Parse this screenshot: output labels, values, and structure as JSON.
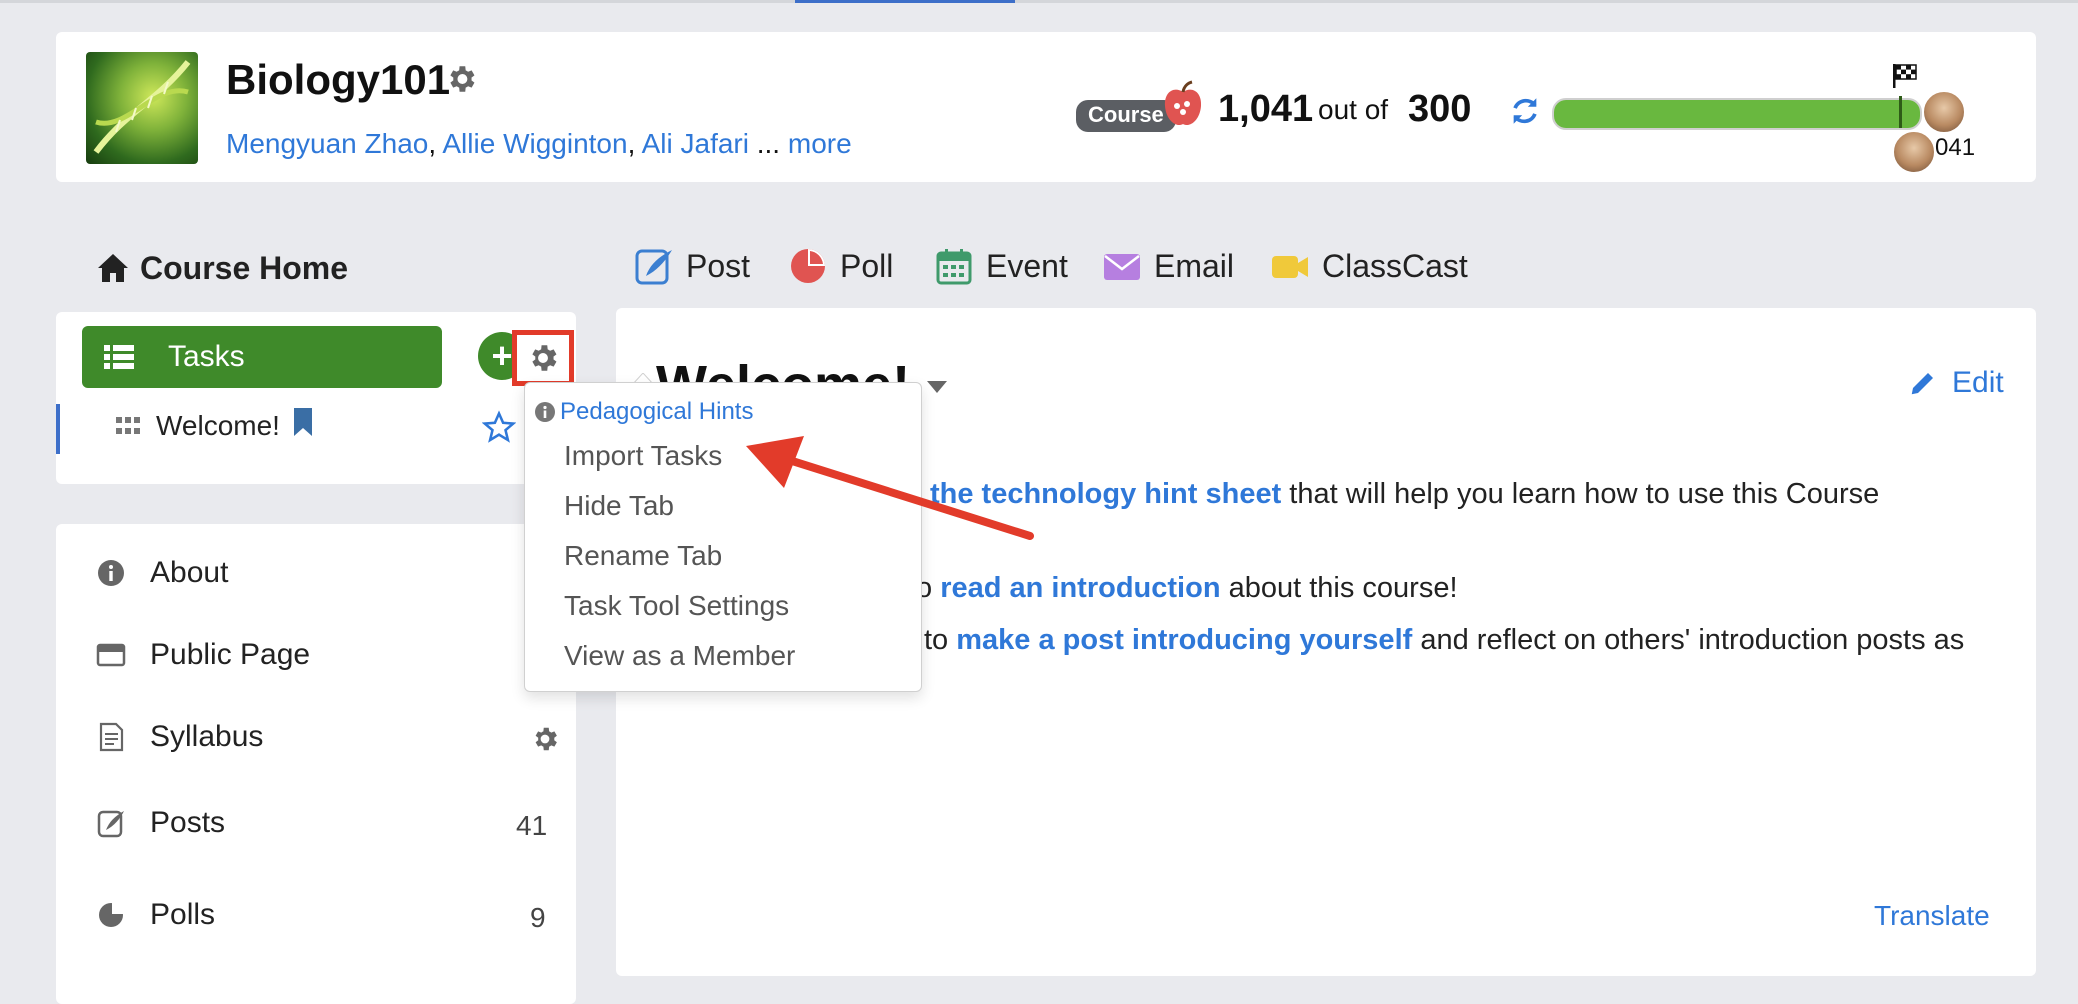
{
  "course": {
    "title": "Biology101",
    "instructors": [
      "Mengyuan Zhao",
      "Allie Wigginton",
      "Ali Jafari"
    ],
    "separator": ",",
    "ellipsis": "...",
    "more_label": "more"
  },
  "points": {
    "badge": "Course",
    "value": "1,041",
    "out_of": "out of",
    "max": "300",
    "progress_fraction": 1.0,
    "avatar_count": "041"
  },
  "sidebar": {
    "home_label": "Course Home",
    "tasks_label": "Tasks",
    "add_label": "+",
    "welcome_item": "Welcome!",
    "nav": [
      {
        "label": "About",
        "icon": "info-icon"
      },
      {
        "label": "Public Page",
        "icon": "window-icon"
      },
      {
        "label": "Syllabus",
        "icon": "document-icon"
      },
      {
        "label": "Posts",
        "icon": "post-icon",
        "count": "41"
      },
      {
        "label": "Polls",
        "icon": "pie-icon",
        "count": "9"
      }
    ]
  },
  "toolbar": {
    "post": "Post",
    "poll": "Poll",
    "event": "Event",
    "email": "Email",
    "classcast": "ClassCast"
  },
  "content": {
    "heading": "Welcome!",
    "edit": "Edit",
    "line1_link": "the technology hint sheet",
    "line1_rest": " that will help you learn how to use this Course",
    "line2_pre": "o ",
    "line2_link": "read an introduction",
    "line2_rest": " about this course!",
    "line3_pre": "to ",
    "line3_link": "make a post introducing yourself",
    "line3_rest": " and reflect on others' introduction posts as",
    "translate": "Translate"
  },
  "menu": {
    "hint": "Pedagogical Hints",
    "items": [
      "Import Tasks",
      "Hide Tab",
      "Rename Tab",
      "Task Tool Settings",
      "View as a Member"
    ]
  },
  "colors": {
    "accent": "#2f78d8",
    "tasks_green": "#3f8a2a",
    "progress_green": "#69b83f",
    "highlight_red": "#e23b2a"
  }
}
